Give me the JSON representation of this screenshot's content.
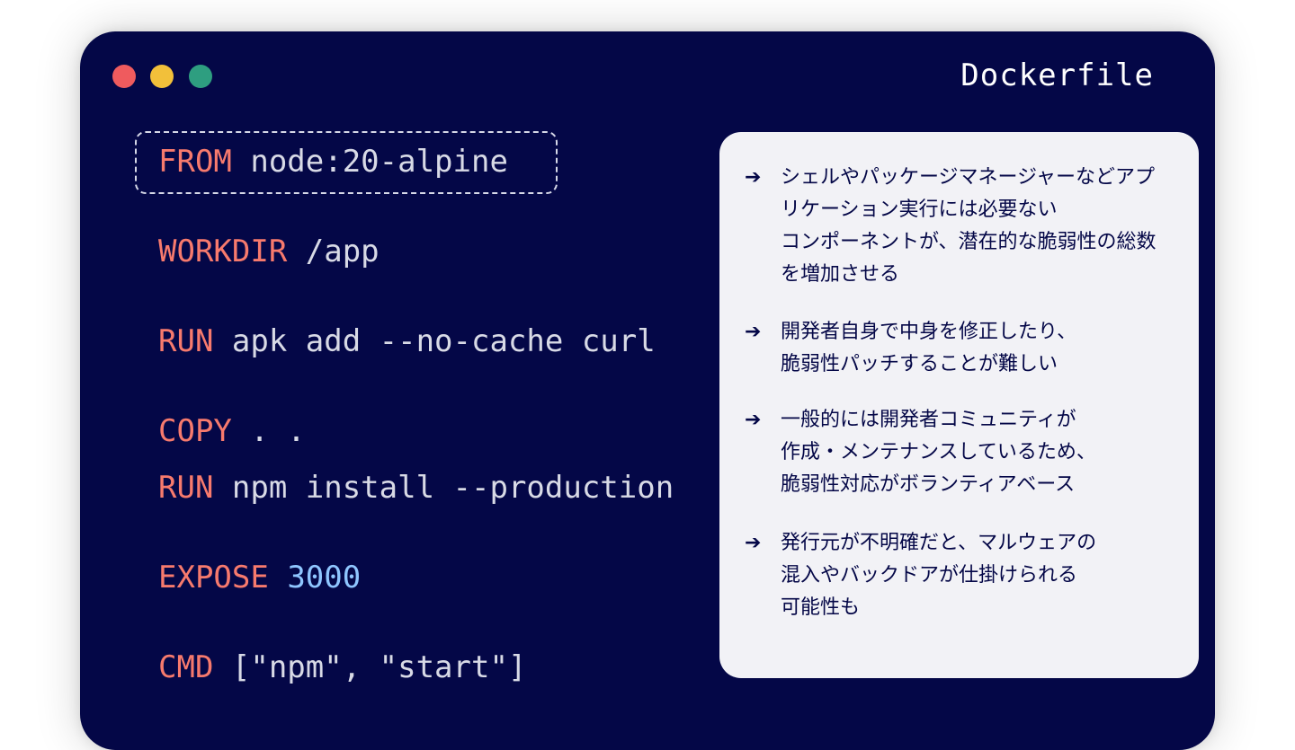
{
  "window": {
    "title": "Dockerfile",
    "background": "#040747",
    "traffic_lights": [
      "#ef5b5e",
      "#f2c03a",
      "#2e9e80"
    ]
  },
  "code": [
    {
      "keyword": "FROM",
      "text": " node:20-alpine",
      "number": "",
      "highlighted": true
    },
    {
      "keyword": "WORKDIR",
      "text": " /app",
      "number": ""
    },
    {
      "keyword": "RUN",
      "text": " apk add --no-cache curl",
      "number": ""
    },
    {
      "keyword": "COPY",
      "text": " . .",
      "number": ""
    },
    {
      "keyword": "RUN",
      "text": " npm install --production",
      "number": ""
    },
    {
      "keyword": "EXPOSE",
      "text": " ",
      "number": "3000"
    },
    {
      "keyword": "CMD",
      "text": " [\"npm\", \"start\"]",
      "number": ""
    }
  ],
  "colors": {
    "keyword": "#f77a6d",
    "number": "#8fc6ff",
    "code_text": "#d8dae6",
    "panel": "#f2f2f6"
  },
  "notes": [
    {
      "icon": "arrow-right-icon",
      "text": "シェルやパッケージマネージャーなどアプ\nリケーション実行には必要ない\nコンポーネントが、潜在的な脆弱性の総数\nを増加させる"
    },
    {
      "icon": "arrow-right-icon",
      "text": "開発者自身で中身を修正したり、\n脆弱性パッチすることが難しい"
    },
    {
      "icon": "arrow-right-icon",
      "text": "一般的には開発者コミュニティが\n作成・メンテナンスしているため、\n脆弱性対応がボランティアベース"
    },
    {
      "icon": "arrow-right-icon",
      "text": "発行元が不明確だと、マルウェアの\n混入やバックドアが仕掛けられる\n可能性も"
    }
  ]
}
